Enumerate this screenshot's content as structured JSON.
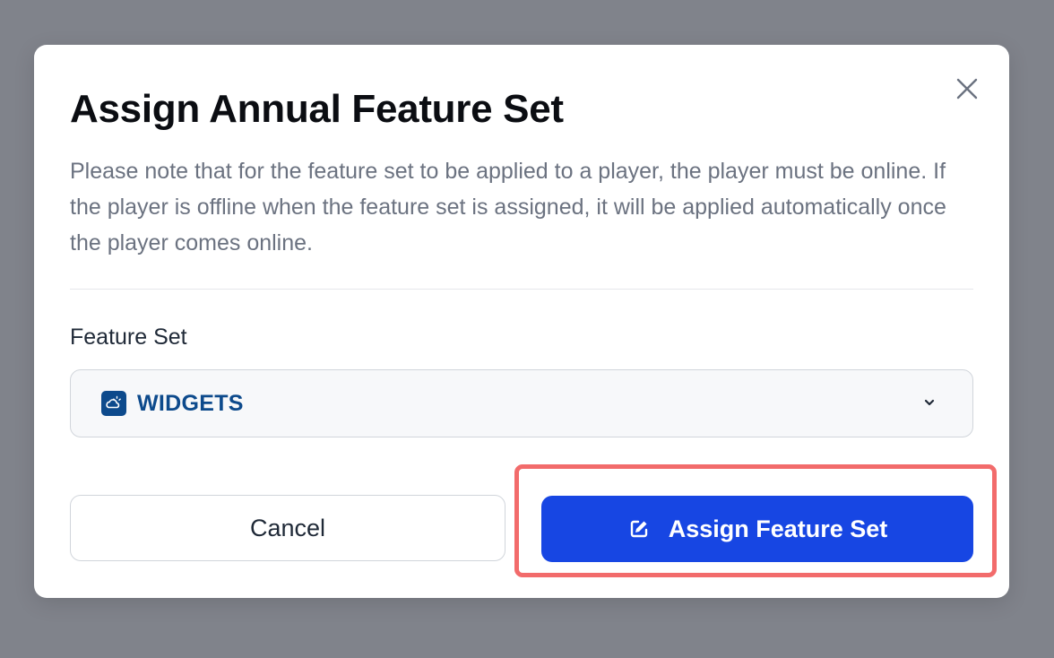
{
  "dialog": {
    "title": "Assign Annual Feature Set",
    "note": "Please note that for the feature set to be applied to a player, the player must be online. If the player is offline when the feature set is assigned, it will be applied automatically once the player comes online.",
    "close_icon": "close-icon"
  },
  "feature_set": {
    "label": "Feature Set",
    "selected": "WIDGETS",
    "selected_icon": "widget-weather-icon",
    "dropdown_icon": "chevron-down-icon"
  },
  "actions": {
    "cancel_label": "Cancel",
    "assign_label": "Assign Feature Set",
    "assign_icon": "edit-icon"
  },
  "colors": {
    "overlay": "#80838b",
    "primary": "#1746e3",
    "selected_value": "#0d4a8c",
    "highlight": "#f26b6b"
  }
}
